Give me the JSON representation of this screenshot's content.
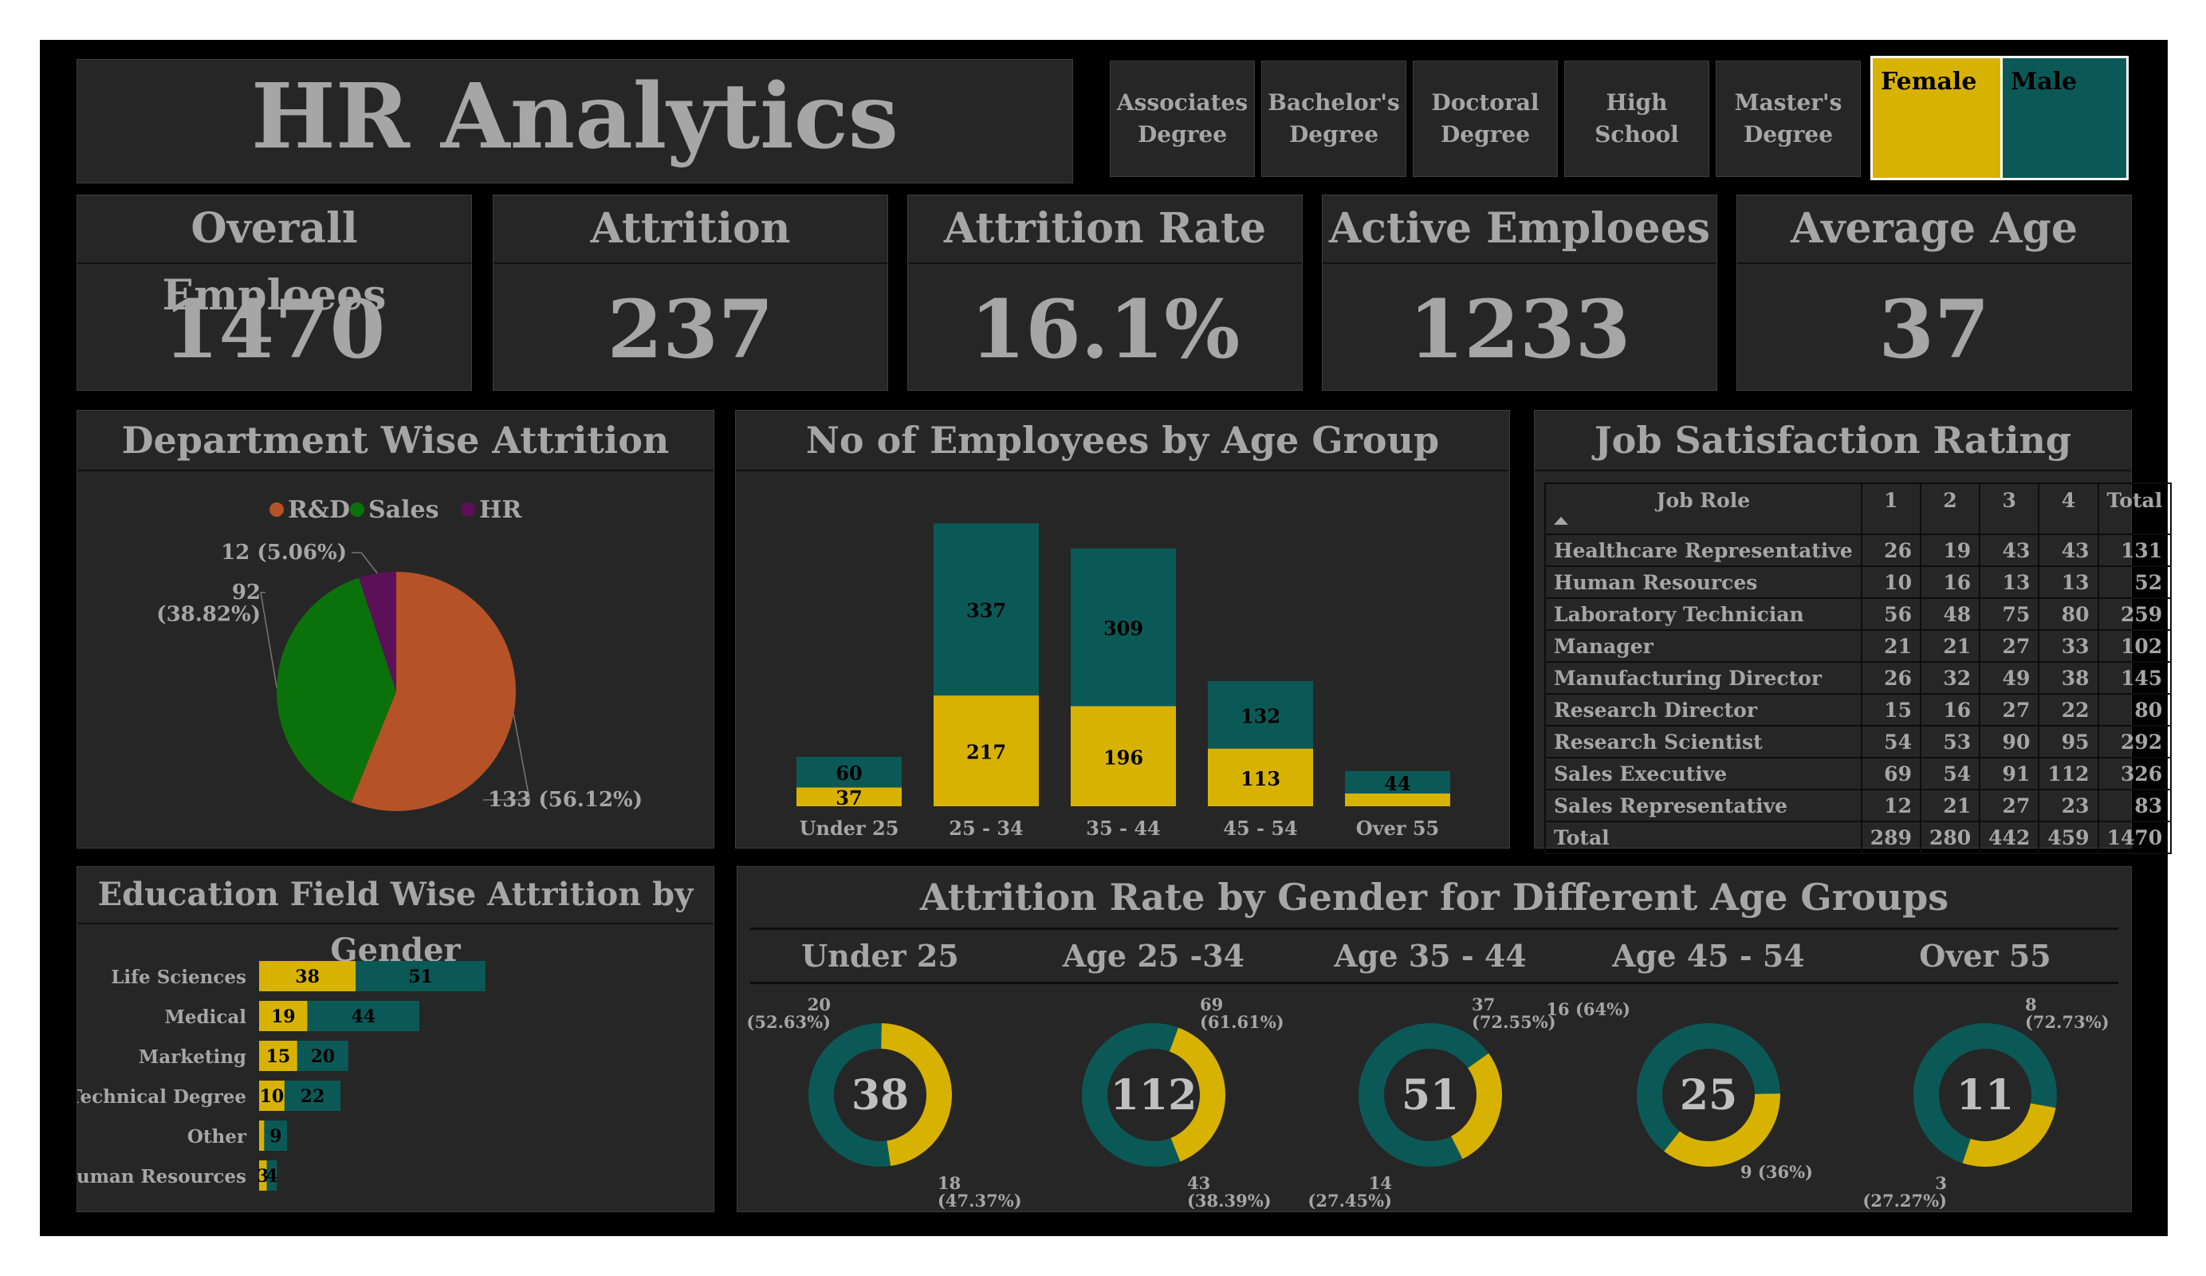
{
  "header": {
    "title": "HR Analytics"
  },
  "education_slicer": [
    "Associates\nDegree",
    "Bachelor's\nDegree",
    "Doctoral\nDegree",
    "High\nSchool",
    "Master's\nDegree"
  ],
  "gender_slicer": {
    "female": "Female",
    "male": "Male",
    "female_color": "#d8b201",
    "male_color": "#0b5957"
  },
  "kpis": [
    {
      "label": "Overall Emploees",
      "value": "1470"
    },
    {
      "label": "Attrition",
      "value": "237"
    },
    {
      "label": "Attrition Rate",
      "value": "16.1%"
    },
    {
      "label": "Active Emploees",
      "value": "1233"
    },
    {
      "label": "Average Age",
      "value": "37"
    }
  ],
  "panels": {
    "dept": "Department Wise Attrition",
    "age_group": "No of Employees by Age Group",
    "job_sat": "Job Satisfaction Rating",
    "edu": "Education Field Wise Attrition by Gender",
    "gender_age": "Attrition Rate by Gender for Different Age Groups"
  },
  "chart_data": [
    {
      "id": "dept",
      "type": "pie",
      "legend": [
        "R&D",
        "Sales",
        "HR"
      ],
      "colors": [
        "#b55227",
        "#0b720b",
        "#5c1058"
      ],
      "values": [
        133,
        92,
        12
      ],
      "labels": [
        "133 (56.12%)",
        "92\n(38.82%)",
        "12 (5.06%)"
      ],
      "legend_position": "top"
    },
    {
      "id": "age_group",
      "type": "bar",
      "stacked": true,
      "categories": [
        "Under 25",
        "25 - 34",
        "35 - 44",
        "45 - 54",
        "Over 55"
      ],
      "series": [
        {
          "name": "Female",
          "values": [
            37,
            217,
            196,
            113,
            25
          ],
          "labels": [
            "37",
            "217",
            "196",
            "113",
            ""
          ]
        },
        {
          "name": "Male",
          "values": [
            60,
            337,
            309,
            132,
            44
          ],
          "labels": [
            "60",
            "337",
            "309",
            "132",
            "44"
          ]
        }
      ]
    },
    {
      "id": "job_sat",
      "type": "table",
      "columns": [
        "Job Role",
        "1",
        "2",
        "3",
        "4",
        "Total"
      ],
      "rows": [
        [
          "Healthcare Representative",
          "26",
          "19",
          "43",
          "43",
          "131"
        ],
        [
          "Human Resources",
          "10",
          "16",
          "13",
          "13",
          "52"
        ],
        [
          "Laboratory Technician",
          "56",
          "48",
          "75",
          "80",
          "259"
        ],
        [
          "Manager",
          "21",
          "21",
          "27",
          "33",
          "102"
        ],
        [
          "Manufacturing Director",
          "26",
          "32",
          "49",
          "38",
          "145"
        ],
        [
          "Research Director",
          "15",
          "16",
          "27",
          "22",
          "80"
        ],
        [
          "Research Scientist",
          "54",
          "53",
          "90",
          "95",
          "292"
        ],
        [
          "Sales Executive",
          "69",
          "54",
          "91",
          "112",
          "326"
        ],
        [
          "Sales Representative",
          "12",
          "21",
          "27",
          "23",
          "83"
        ],
        [
          "Total",
          "289",
          "280",
          "442",
          "459",
          "1470"
        ]
      ]
    },
    {
      "id": "edu",
      "type": "bar",
      "orientation": "horizontal",
      "stacked": true,
      "categories": [
        "Life Sciences",
        "Medical",
        "Marketing",
        "Technical Degree",
        "Other",
        "Human Resources"
      ],
      "series": [
        {
          "name": "Female",
          "values": [
            38,
            19,
            15,
            10,
            2,
            3
          ],
          "labels": [
            "38",
            "19",
            "15",
            "10",
            "",
            "3"
          ]
        },
        {
          "name": "Male",
          "values": [
            51,
            44,
            20,
            22,
            9,
            4
          ],
          "labels": [
            "51",
            "44",
            "20",
            "22",
            "9",
            "4"
          ]
        }
      ]
    },
    {
      "id": "gender_age",
      "type": "pie",
      "donut": true,
      "groups": [
        {
          "title": "Under 25",
          "center": "38",
          "male": 20,
          "female": 18,
          "male_label": "20\n(52.63%)",
          "female_label": "18\n(47.37%)"
        },
        {
          "title": "Age 25 -34",
          "center": "112",
          "male": 69,
          "female": 43,
          "male_label": "69\n(61.61%)",
          "female_label": "43\n(38.39%)"
        },
        {
          "title": "Age 35 - 44",
          "center": "51",
          "male": 37,
          "female": 14,
          "male_label": "37\n(72.55%)",
          "female_label": "14\n(27.45%)"
        },
        {
          "title": "Age 45 - 54",
          "center": "25",
          "male": 16,
          "female": 9,
          "male_label": "16 (64%)",
          "female_label": "9 (36%)"
        },
        {
          "title": "Over 55",
          "center": "11",
          "male": 8,
          "female": 3,
          "male_label": "8\n(72.73%)",
          "female_label": "3\n(27.27%)"
        }
      ]
    }
  ]
}
